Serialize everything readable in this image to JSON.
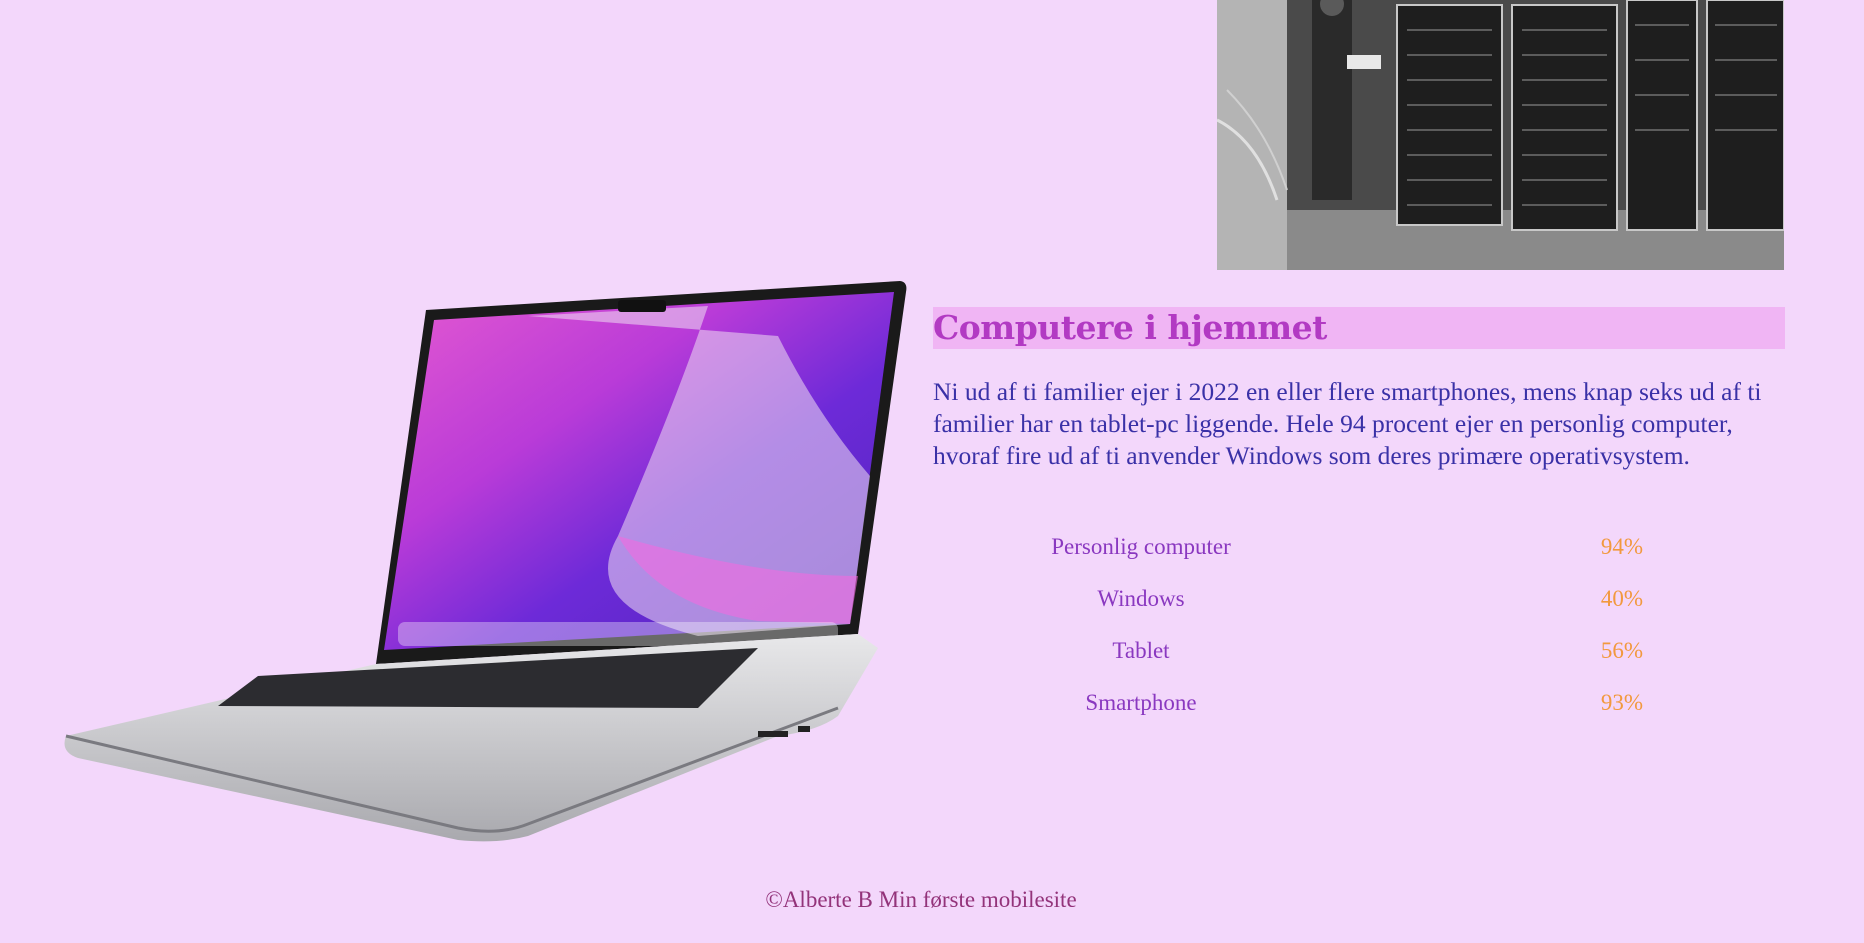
{
  "section": {
    "heading": "Computere i hjemmet",
    "intro": "Ni ud af ti familier ejer i 2022 en eller flere smartphones, mens knap seks ud af ti familier har en tablet-pc liggende. Hele 94 procent ejer en personlig computer, hvoraf fire ud af ti anvender Windows som deres primære operativsystem.",
    "stats": [
      {
        "label": "Personlig computer",
        "value": "94%"
      },
      {
        "label": "Windows",
        "value": "40%"
      },
      {
        "label": "Tablet",
        "value": "56%"
      },
      {
        "label": "Smartphone",
        "value": "93%"
      }
    ]
  },
  "footer": {
    "text": "©Alberte B Min første mobilesite"
  },
  "colors": {
    "background": "#f3d7fb",
    "heading_bg": "#f0b5f4",
    "heading_text": "#b23ac3",
    "body_text": "#3a31a7",
    "stat_label": "#8a38c0",
    "stat_value": "#f2993e",
    "footer_text": "#93337a"
  }
}
